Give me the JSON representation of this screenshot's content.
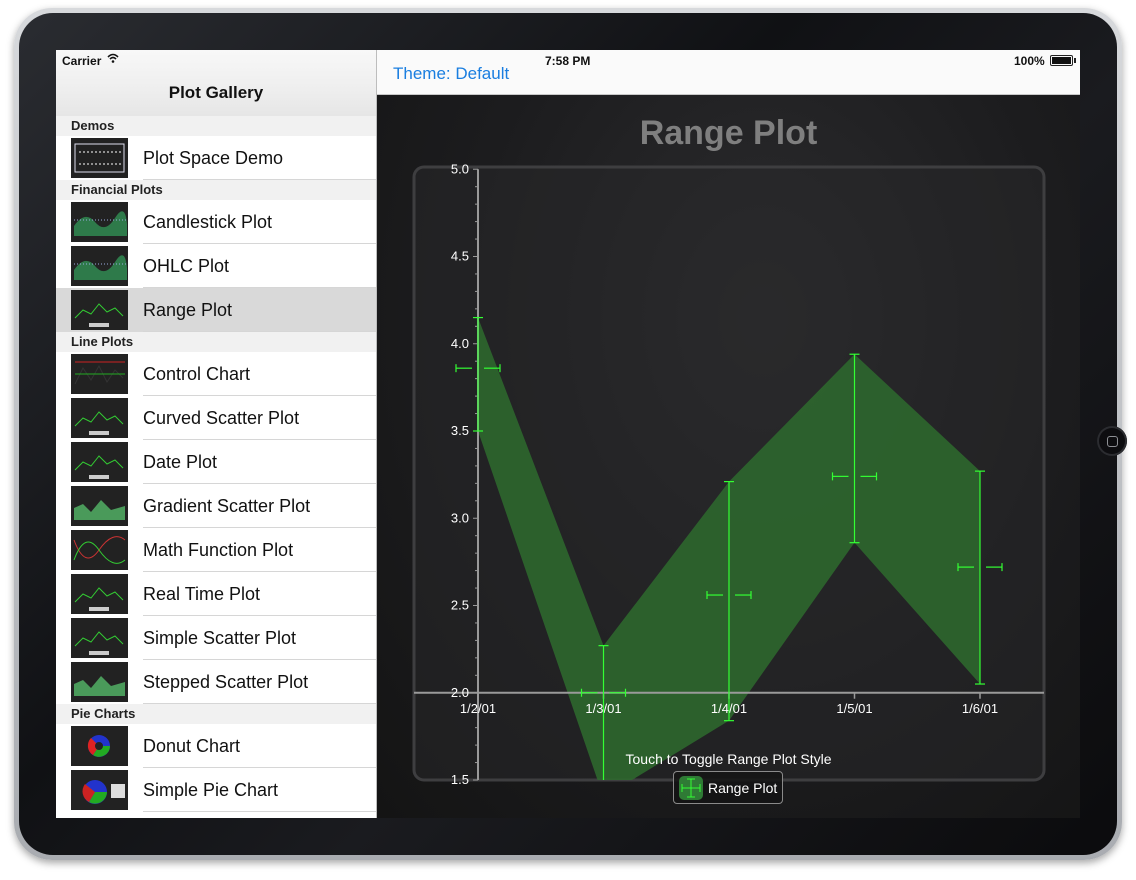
{
  "status_bar": {
    "carrier": "Carrier",
    "time": "7:58 PM",
    "battery": "100%"
  },
  "master": {
    "title": "Plot Gallery",
    "sections": [
      {
        "name": "Demos",
        "items": [
          "Plot Space Demo"
        ]
      },
      {
        "name": "Financial Plots",
        "items": [
          "Candlestick Plot",
          "OHLC Plot",
          "Range Plot"
        ]
      },
      {
        "name": "Line Plots",
        "items": [
          "Control Chart",
          "Curved Scatter Plot",
          "Date Plot",
          "Gradient Scatter Plot",
          "Math Function Plot",
          "Real Time Plot",
          "Simple Scatter Plot",
          "Stepped Scatter Plot"
        ]
      },
      {
        "name": "Pie Charts",
        "items": [
          "Donut Chart",
          "Simple Pie Chart"
        ]
      }
    ],
    "selected_item": "Range Plot"
  },
  "detail": {
    "theme_button": "Theme: Default",
    "touch_hint": "Touch to Toggle Range Plot Style",
    "legend_label": "Range Plot"
  },
  "colors": {
    "accent": "#1a7ee0",
    "range_fill": "#2e6b2e",
    "error_bars": "#33ff33",
    "plot_title": "#7f7f7f"
  },
  "chart_data": {
    "type": "area",
    "title": "Range Plot",
    "x": [
      "1/2/01",
      "1/3/01",
      "1/4/01",
      "1/5/01",
      "1/6/01"
    ],
    "series": [
      {
        "name": "Range Plot",
        "y": [
          3.86,
          2.0,
          2.56,
          3.24,
          2.72
        ],
        "high": [
          4.15,
          2.27,
          3.21,
          3.94,
          3.27
        ],
        "low": [
          3.5,
          1.4,
          1.84,
          2.86,
          2.05
        ]
      }
    ],
    "xlabel": "",
    "ylabel": "",
    "ylim": [
      1.5,
      5.0
    ],
    "yticks": [
      "1.5",
      "2.0",
      "2.5",
      "3.0",
      "3.5",
      "4.0",
      "4.5",
      "5.0"
    ],
    "grid": false,
    "legend": "bottom-center"
  }
}
